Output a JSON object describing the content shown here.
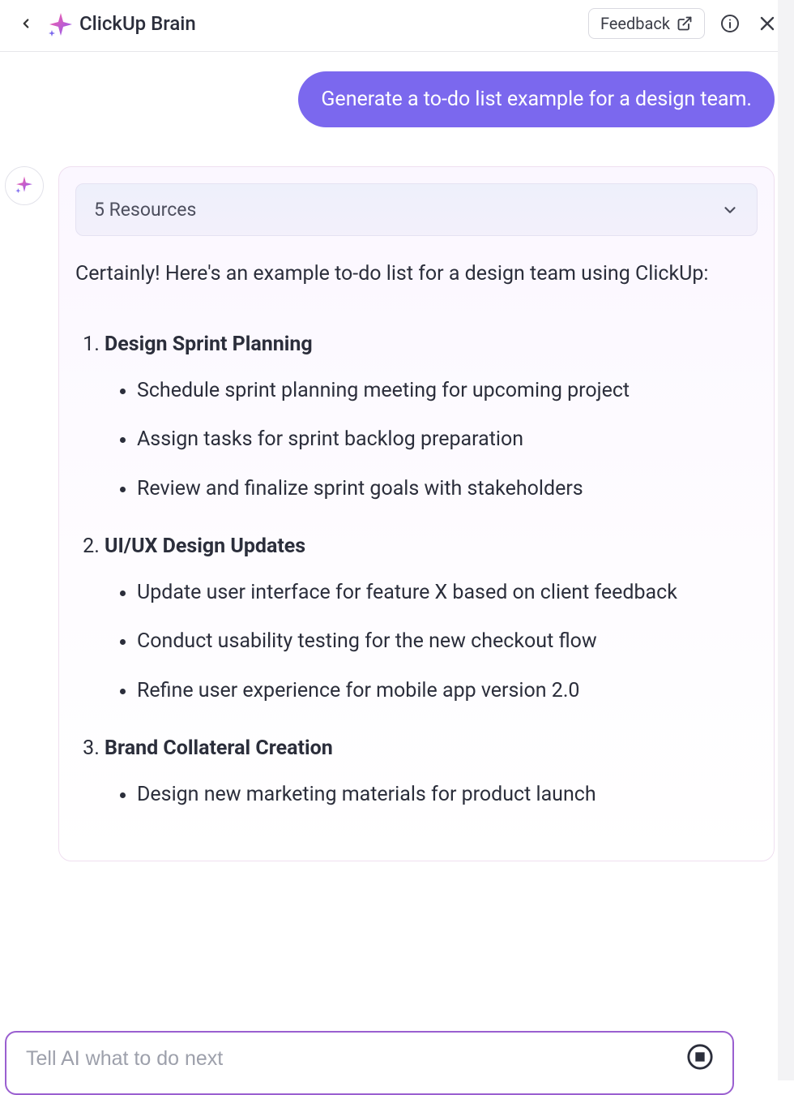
{
  "header": {
    "title": "ClickUp Brain",
    "feedback_label": "Feedback"
  },
  "chat": {
    "user_prompt": "Generate a to-do list example for a design team.",
    "resources_label": "5 Resources",
    "intro": "Certainly! Here's an example to-do list for a design team using ClickUp:",
    "sections": [
      {
        "title": "Design Sprint Planning",
        "items": [
          "Schedule sprint planning meeting for upcoming project",
          "Assign tasks for sprint backlog preparation",
          "Review and finalize sprint goals with stakeholders"
        ]
      },
      {
        "title": "UI/UX Design Updates",
        "items": [
          "Update user interface for feature X based on client feedback",
          "Conduct usability testing for the new checkout flow",
          "Refine user experience for mobile app version 2.0"
        ]
      },
      {
        "title": "Brand Collateral Creation",
        "items": [
          "Design new marketing materials for product launch"
        ]
      }
    ]
  },
  "input": {
    "placeholder": "Tell AI what to do next"
  },
  "colors": {
    "accent": "#7b68ee",
    "border_purple": "#9a5fd0"
  }
}
